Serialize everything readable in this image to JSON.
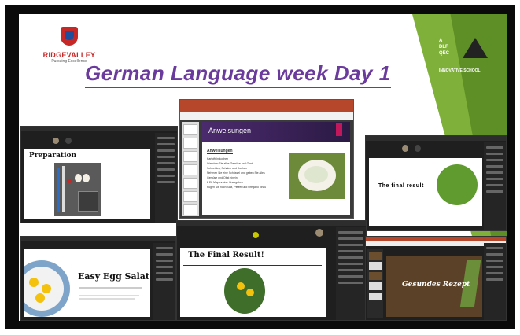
{
  "school": {
    "name": "RIDGEVALLEY",
    "tagline": "Pursuing Excellence"
  },
  "title": "German Language week Day 1",
  "partner": {
    "a": "A",
    "dlf": "DLF",
    "qec": "QEC",
    "school": "INNOVATIVE SCHOOL"
  },
  "ppt": {
    "slide_header": "Anweisungen",
    "subheading": "Anweisungen",
    "steps": [
      "Kartoffeln kochen",
      "Waschen Sie alles Gemüse und Obst",
      "Schneiden, Schälen und Kochen",
      "Nehmen Sie eine Schüssel und geben Sie alles Gemüse und Obst hinein",
      "2 EL Mayonnaise hinzugeben",
      "Fügen Sie noch Salz, Pfeffer und Oregano hinzu"
    ]
  },
  "windows": {
    "preparation": "Preparation",
    "final_result": "The final result",
    "easy_egg": "Easy Egg Salat!",
    "final_result2": "The Final Result!",
    "gesundes": "Gesundes Rezept"
  },
  "colors": {
    "title_purple": "#6a3a9c",
    "green_light": "#7fb03a",
    "green_dark": "#5e8f26",
    "ppt_red": "#b7472a",
    "slide_purple": "#4b2a6d"
  }
}
